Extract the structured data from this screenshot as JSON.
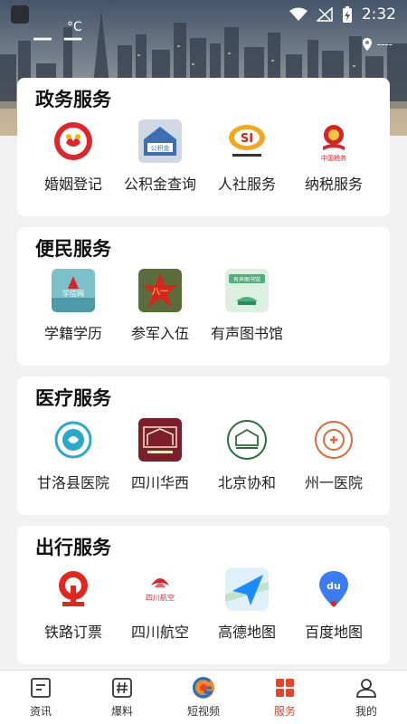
{
  "status_bar": {
    "time": "2:32"
  },
  "weather": {
    "temp": "— —",
    "unit": "°C",
    "location": "----"
  },
  "sections": [
    {
      "title": "政务服务",
      "items": [
        {
          "label": "婚姻登记",
          "icon": "marriage-registration-icon"
        },
        {
          "label": "公积金查询",
          "icon": "housing-fund-icon",
          "icon_text": "公积金"
        },
        {
          "label": "人社服务",
          "icon": "social-security-icon"
        },
        {
          "label": "纳税服务",
          "icon": "tax-service-icon",
          "icon_text": "中国税务"
        }
      ]
    },
    {
      "title": "便民服务",
      "items": [
        {
          "label": "学籍学历",
          "icon": "student-records-icon",
          "icon_text": "学信网"
        },
        {
          "label": "参军入伍",
          "icon": "military-enlistment-icon",
          "icon_text": "八一"
        },
        {
          "label": "有声图书馆",
          "icon": "audio-library-icon",
          "icon_text": "有声图书馆"
        }
      ]
    },
    {
      "title": "医疗服务",
      "items": [
        {
          "label": "甘洛县医院",
          "icon": "ganluo-hospital-icon"
        },
        {
          "label": "四川华西",
          "icon": "west-china-hospital-icon"
        },
        {
          "label": "北京协和",
          "icon": "peking-union-hospital-icon"
        },
        {
          "label": "州一医院",
          "icon": "prefecture-first-hospital-icon"
        }
      ]
    },
    {
      "title": "出行服务",
      "items": [
        {
          "label": "铁路订票",
          "icon": "railway-ticket-icon"
        },
        {
          "label": "四川航空",
          "icon": "sichuan-airlines-icon",
          "icon_text": "四川航空"
        },
        {
          "label": "高德地图",
          "icon": "amap-icon"
        },
        {
          "label": "百度地图",
          "icon": "baidu-map-icon",
          "icon_text": "du"
        }
      ]
    }
  ],
  "tabbar": [
    {
      "label": "资讯",
      "icon": "news-icon"
    },
    {
      "label": "爆料",
      "icon": "hashtag-icon"
    },
    {
      "label": "短视频",
      "icon": "video-logo-icon"
    },
    {
      "label": "服务",
      "icon": "services-grid-icon",
      "active": true
    },
    {
      "label": "我的",
      "icon": "profile-icon"
    }
  ],
  "colors": {
    "accent": "#e8432d",
    "background": "#f2f2f2"
  }
}
